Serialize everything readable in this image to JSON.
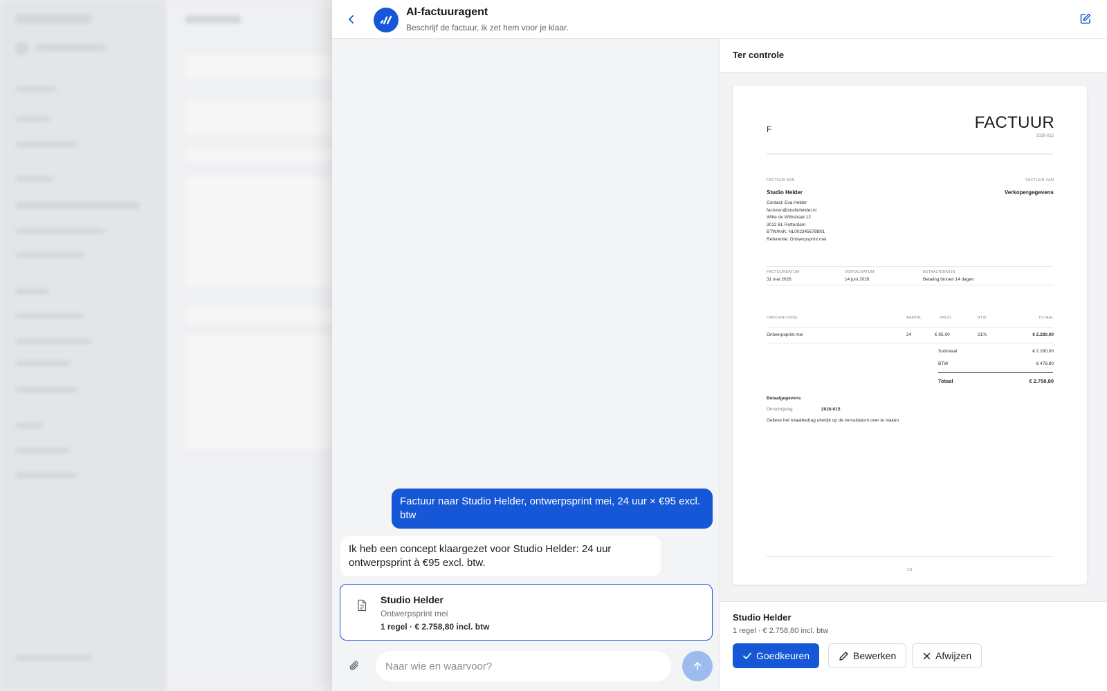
{
  "header": {
    "title": "AI-factuuragent",
    "subtitle": "Beschrijf de factuur, ik zet hem voor je klaar."
  },
  "chat": {
    "user_message": "Factuur naar Studio Helder, ontwerpsprint mei, 24 uur × €95 excl. btw",
    "agent_message": "Ik heb een concept klaargezet voor Studio Helder: 24 uur ontwerpsprint à €95 excl. btw.",
    "draft": {
      "title": "Studio Helder",
      "subtitle": "Ontwerpsprint mei",
      "meta": "1 regel · € 2.758,80 incl. btw"
    },
    "input_placeholder": "Naar wie en waarvoor?",
    "input_value": ""
  },
  "review": {
    "title": "Ter controle",
    "footer": {
      "title": "Studio Helder",
      "meta": "1 regel · € 2.758,80 incl. btw",
      "approve": "Goedkeuren",
      "edit": "Bewerken",
      "reject": "Afwijzen"
    }
  },
  "invoice": {
    "logo_letter": "F",
    "title": "FACTUUR",
    "number": "2026-015",
    "to_label": "FACTUUR AAN",
    "from_label": "FACTUUR VAN",
    "client_name": "Studio Helder",
    "seller": "Verkopergegevens",
    "client_lines": [
      "Contact: Eva Helder",
      "facturen@studiohelder.nl",
      "Witte de Withstraat 12",
      "3012 BL Rotterdam",
      "BTW/KvK: NL002345678B01",
      "Referentie: Ontwerpsprint mei"
    ],
    "dates": {
      "invoice_date_label": "FACTUURDATUM",
      "invoice_date": "31 mei 2026",
      "due_date_label": "VERVALDATUM",
      "due_date": "14 juni 2026",
      "terms_label": "BETAALTERMIJN",
      "terms": "Betaling binnen 14 dagen"
    },
    "columns": {
      "description": "OMSCHRIJVING",
      "qty": "AANTAL",
      "price": "PRIJS",
      "vat": "BTW",
      "total": "TOTAAL"
    },
    "line": {
      "description": "Ontwerpsprint mei",
      "qty": "24",
      "price": "€ 95,00",
      "vat": "21%",
      "total": "€ 2.280,00"
    },
    "subtotal_label": "Subtotaal",
    "subtotal": "€ 2.280,00",
    "vat_label": "BTW",
    "vat_amount": "€ 478,80",
    "total_label": "Totaal",
    "total": "€ 2.758,80",
    "payment_title": "Betaalgegevens",
    "payment_desc_label": "Omschrijving",
    "payment_desc": "2026-015",
    "payment_note": "Gelieve het totaalbedrag uiterlijk op de vervaldatum over te maken.",
    "page": "1/1"
  },
  "colors": {
    "accent": "#1557d6",
    "send_disabled": "#9cbcf0"
  }
}
